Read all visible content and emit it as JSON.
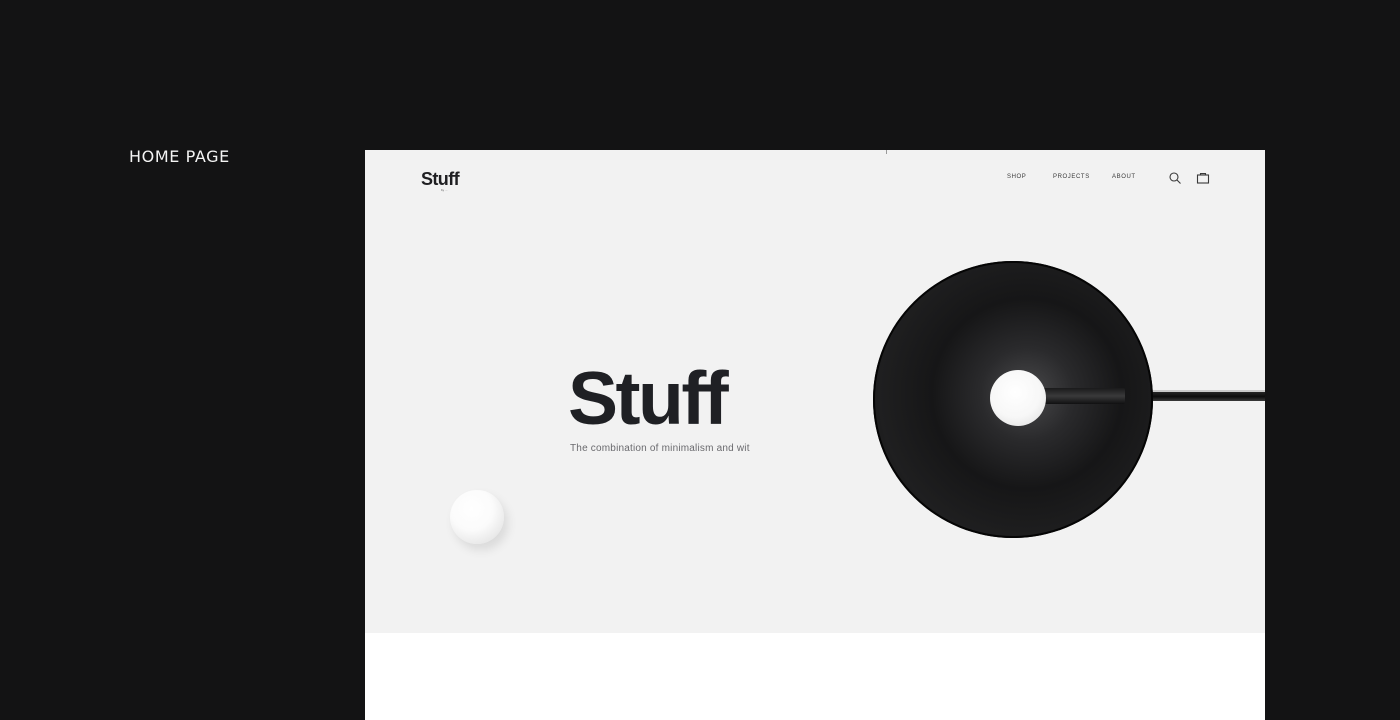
{
  "section_label": "HOME PAGE",
  "site": {
    "logo": "Stuff",
    "logo_subtitle": "by ..."
  },
  "nav": {
    "items": [
      {
        "label": "SHOP"
      },
      {
        "label": "PROJECTS"
      },
      {
        "label": "ABOUT"
      }
    ],
    "icons": [
      "search-icon",
      "bag-icon"
    ]
  },
  "hero": {
    "title": "Stuff",
    "subtitle": "The combination of minimalism and wit"
  },
  "colors": {
    "page_background": "#131314",
    "hero_background": "#f2f2f2",
    "text_dark": "#1f2024",
    "text_muted": "#6a6a6e",
    "frame_background": "#ffffff"
  }
}
